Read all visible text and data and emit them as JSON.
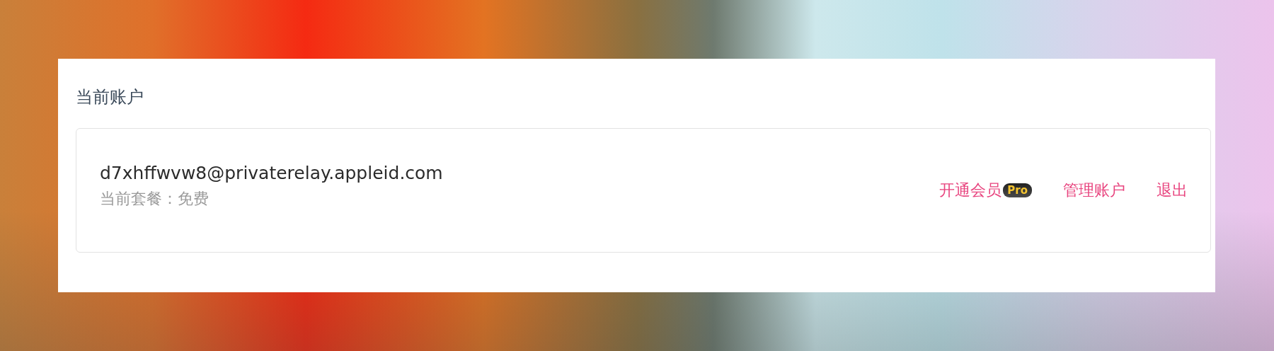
{
  "section": {
    "title": "当前账户"
  },
  "account": {
    "email": "d7xhffwvw8@privaterelay.appleid.com",
    "plan": "当前套餐：免费"
  },
  "actions": [
    {
      "label": "开通会员",
      "badge": "Pro"
    },
    {
      "label": "管理账户"
    },
    {
      "label": "退出"
    }
  ]
}
